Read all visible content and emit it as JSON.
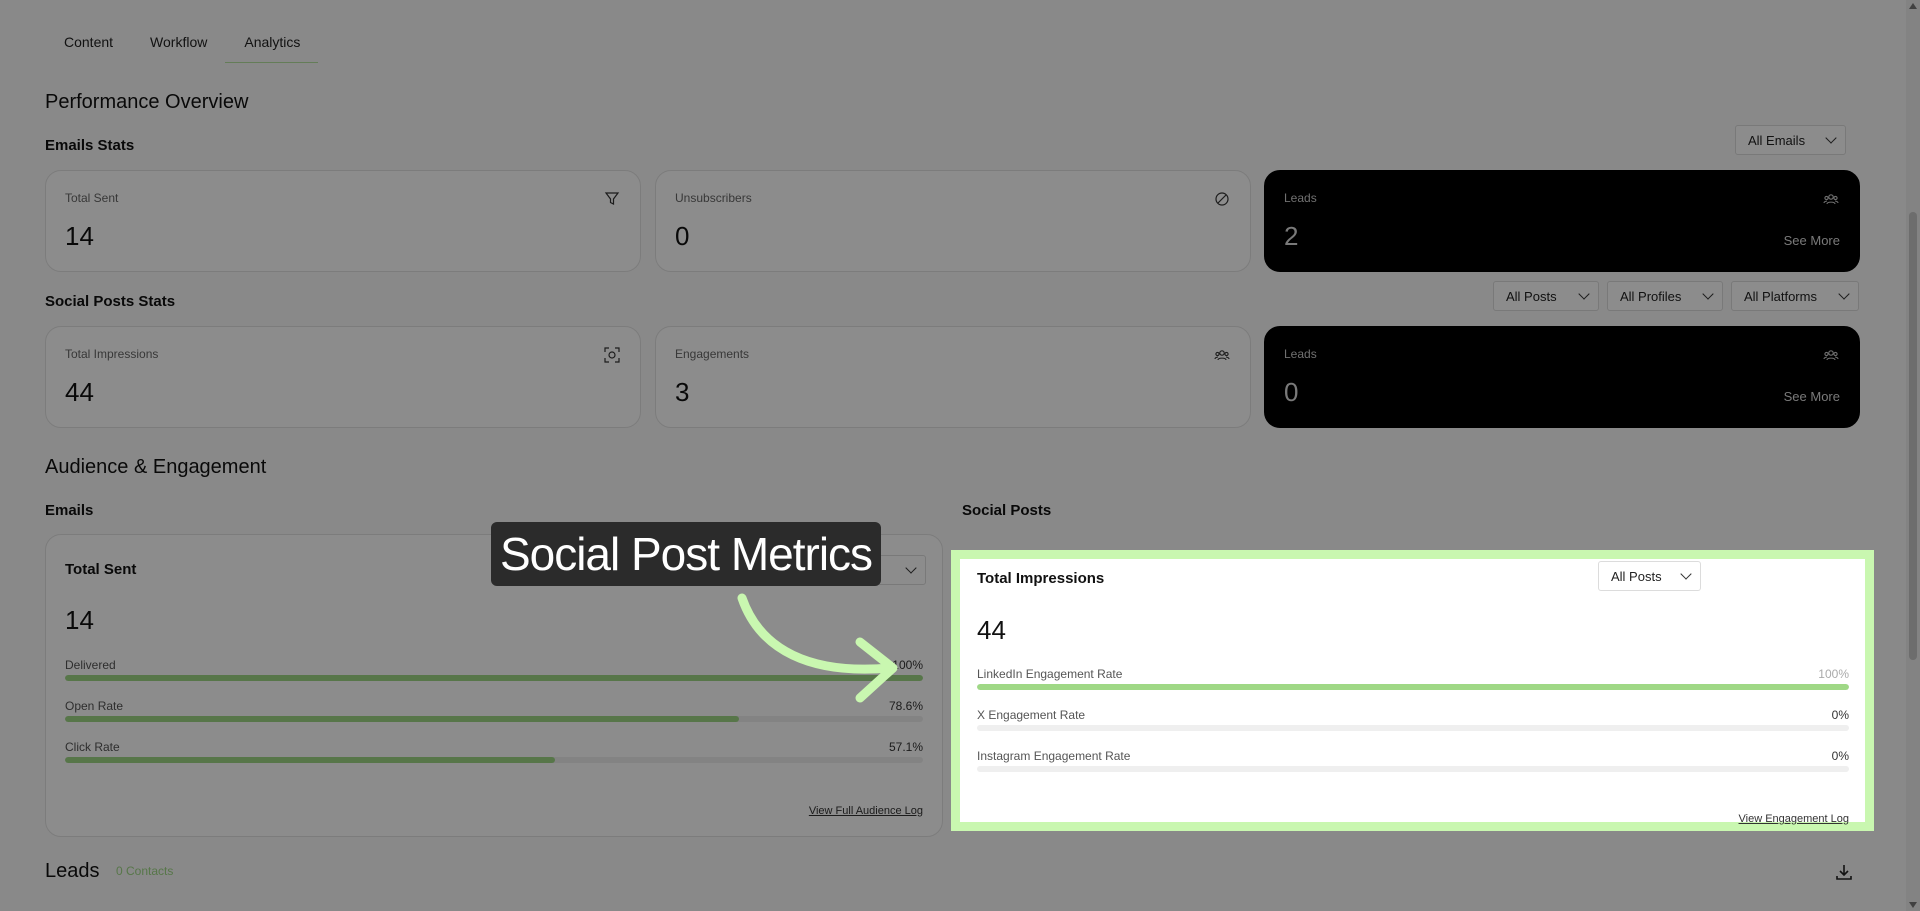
{
  "tabs": [
    {
      "label": "Content"
    },
    {
      "label": "Workflow"
    },
    {
      "label": "Analytics"
    }
  ],
  "performance": {
    "title": "Performance Overview",
    "emails_title": "Emails Stats",
    "emails_filter": "All Emails",
    "email_cards": [
      {
        "label": "Total Sent",
        "value": "14",
        "icon": "funnel-icon"
      },
      {
        "label": "Unsubscribers",
        "value": "0",
        "icon": "block-icon"
      },
      {
        "label": "Leads",
        "value": "2",
        "icon": "people-icon",
        "more": "See More"
      }
    ],
    "social_title": "Social Posts Stats",
    "social_filters": [
      "All Posts",
      "All Profiles",
      "All Platforms"
    ],
    "social_cards": [
      {
        "label": "Total Impressions",
        "value": "44",
        "icon": "scan-icon"
      },
      {
        "label": "Engagements",
        "value": "3",
        "icon": "people-icon"
      },
      {
        "label": "Leads",
        "value": "0",
        "icon": "people-icon",
        "more": "See More"
      }
    ]
  },
  "audience": {
    "title": "Audience & Engagement",
    "emails_title": "Emails",
    "social_title": "Social Posts",
    "email_panel": {
      "title": "Total Sent",
      "filter": "ils",
      "value": "14",
      "metrics": [
        {
          "label": "Delivered",
          "value": "100%",
          "fill": 100
        },
        {
          "label": "Open Rate",
          "value": "78.6%",
          "fill": 78.6
        },
        {
          "label": "Click Rate",
          "value": "57.1%",
          "fill": 57.1
        }
      ],
      "link": "View Full Audience Log"
    },
    "social_panel": {
      "title": "Total Impressions",
      "filter": "All Posts",
      "value": "44",
      "metrics": [
        {
          "label": "LinkedIn Engagement Rate",
          "value": "100%",
          "fill": 100
        },
        {
          "label": "X Engagement Rate",
          "value": "0%",
          "fill": 0
        },
        {
          "label": "Instagram Engagement Rate",
          "value": "0%",
          "fill": 0
        }
      ],
      "link": "View Engagement Log"
    }
  },
  "leads": {
    "title": "Leads",
    "count": "0 Contacts"
  },
  "callout": {
    "text": "Social Post Metrics"
  },
  "colors": {
    "accent": "#9fd886",
    "highlight": "#c9f7b0",
    "dark_card": "#000000"
  }
}
